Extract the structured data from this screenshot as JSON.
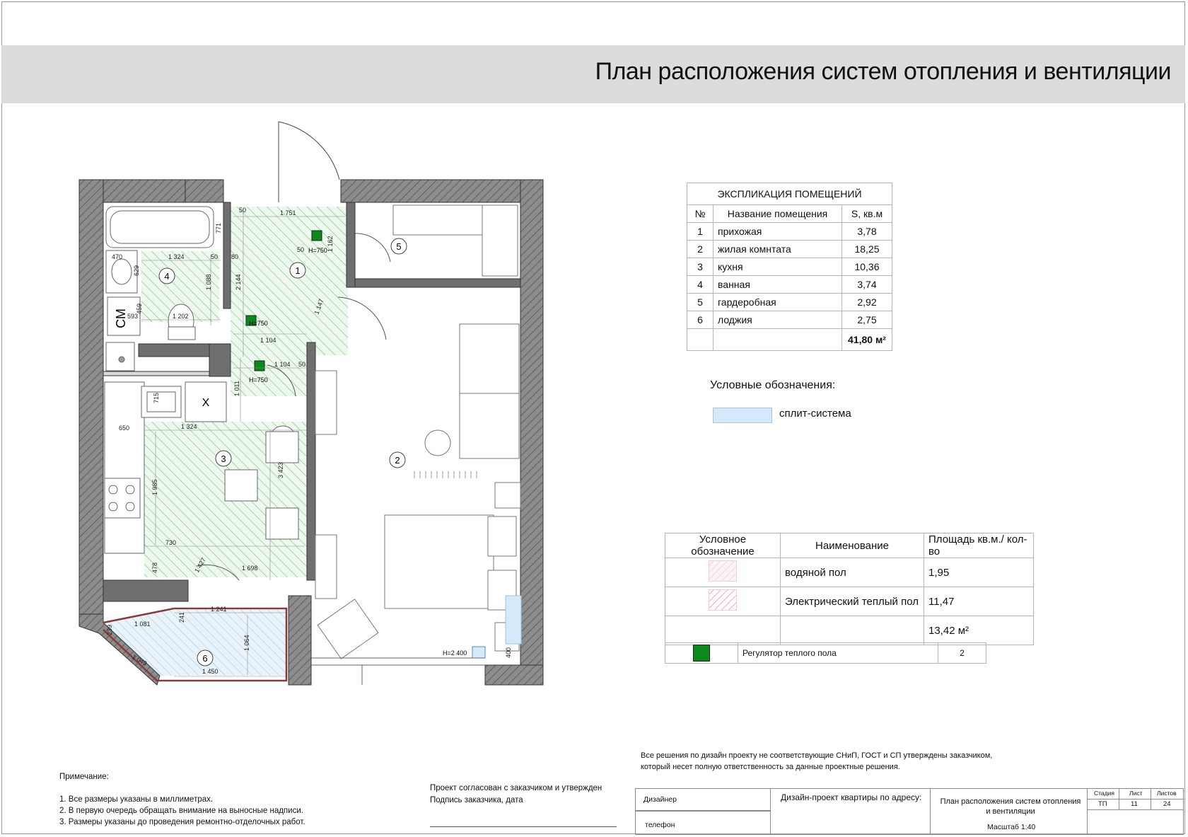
{
  "title": "План расположения систем отопления и вентиляции",
  "plan": {
    "rooms": [
      {
        "number": "1"
      },
      {
        "number": "2"
      },
      {
        "number": "3"
      },
      {
        "number": "4"
      },
      {
        "number": "5"
      },
      {
        "number": "6"
      }
    ],
    "fixture_labels": {
      "washer": "СМ",
      "fridge": "Х"
    },
    "regulator_height": "Н=750",
    "split_height": "Н=2 400",
    "dimensions": [
      "1 751",
      "1 324",
      "50",
      "80",
      "470",
      "629",
      "1 088",
      "2 144",
      "1 162",
      "459",
      "1 202",
      "593",
      "1 104",
      "1 147",
      "1 104",
      "50",
      "1 011",
      "715",
      "650",
      "1 324",
      "1 985",
      "3 423",
      "730",
      "478",
      "1 427",
      "1 698",
      "1 241",
      "241",
      "1 081",
      "239",
      "1 064",
      "1 049",
      "1 450",
      "400",
      "771",
      "50",
      "50"
    ]
  },
  "explication": {
    "title": "ЭКСПЛИКАЦИЯ ПОМЕЩЕНИЙ",
    "headers": [
      "№",
      "Название помещения",
      "S, кв.м"
    ],
    "rows": [
      {
        "n": "1",
        "name": "прихожая",
        "area": "3,78"
      },
      {
        "n": "2",
        "name": "жилая комнтата",
        "area": "18,25"
      },
      {
        "n": "3",
        "name": "кухня",
        "area": "10,36"
      },
      {
        "n": "4",
        "name": "ванная",
        "area": "3,74"
      },
      {
        "n": "5",
        "name": "гардеробная",
        "area": "2,92"
      },
      {
        "n": "6",
        "name": "лоджия",
        "area": "2,75"
      }
    ],
    "total": "41,80 м²"
  },
  "legend": {
    "title": "Условные обозначения:",
    "split_label": "сплит-система",
    "split_color": "#d6e9fb"
  },
  "heating": {
    "headers": [
      "Условное обозначение",
      "Наименование",
      "Площадь  кв.м./ кол-во"
    ],
    "rows": [
      {
        "name": "водяной пол",
        "value": "1,95"
      },
      {
        "name": "Электрический теплый пол",
        "value": "11,47"
      }
    ],
    "total": "13,42 м²",
    "regulator": {
      "name": "Регулятор теплого пола",
      "count": "2",
      "color": "#0a8a1a"
    }
  },
  "notes": {
    "title": "Примечание:",
    "items": [
      "1. Все размеры указаны в миллиметрах.",
      "2. В первую очередь обращать внимание на выносные надписи.",
      "3. Размеры указаны до проведения ремонтно-отделочных работ."
    ]
  },
  "approval": {
    "line1": "Проект согласован с заказчиком и утвержден",
    "line2": "Подпись заказчика, дата"
  },
  "disclaimer": [
    "Все решения по дизайн проекту не соответствующие СНиП, ГОСТ и СП утверждены заказчиком,",
    "который несет полную ответственность за данные проектные решения."
  ],
  "stamp": {
    "designer": "Дизайнер",
    "phone": "телефон",
    "project": "Дизайн-проект квартиры по адресу:",
    "sheet_title": "План расположения систем отопления и вентиляции",
    "scale": "Масштаб 1:40",
    "stage_label": "Стадия",
    "sheet_label": "Лист",
    "sheets_label": "Листов",
    "stage": "ТП",
    "sheet": "11",
    "sheets": "24"
  }
}
